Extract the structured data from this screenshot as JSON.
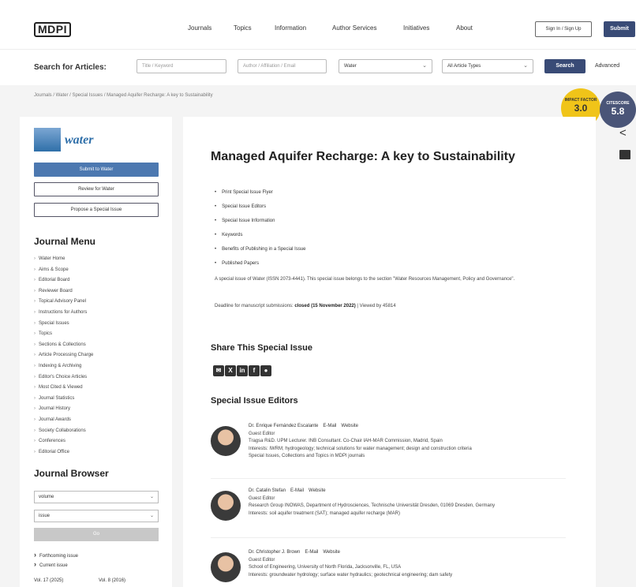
{
  "header": {
    "logo": "MDPI",
    "nav": [
      "Journals",
      "Topics",
      "Information",
      "Author Services",
      "Initiatives",
      "About"
    ],
    "sign_in": "Sign In / Sign Up",
    "submit": "Submit"
  },
  "search": {
    "label": "Search for Articles:",
    "title_placeholder": "Title / Keyword",
    "author_placeholder": "Author / Affiliation / Email",
    "journal_value": "Water",
    "type_value": "All Article Types",
    "search_button": "Search",
    "advanced": "Advanced"
  },
  "breadcrumb": "Journals / Water / Special Issues / Managed Aquifer Recharge: A key to Sustainability",
  "badges": {
    "impact_label": "IMPACT FACTOR",
    "impact_value": "3.0",
    "citescore_label": "CITESCORE",
    "citescore_value": "5.8"
  },
  "sidebar": {
    "journal_name": "water",
    "buttons": [
      "Submit to Water",
      "Review for Water",
      "Propose a Special Issue"
    ],
    "menu_title": "Journal Menu",
    "menu": [
      "Water Home",
      "Aims & Scope",
      "Editorial Board",
      "Reviewer Board",
      "Topical Advisory Panel",
      "Instructions for Authors",
      "Special Issues",
      "Topics",
      "Sections & Collections",
      "Article Processing Charge",
      "Indexing & Archiving",
      "Editor's Choice Articles",
      "Most Cited & Viewed",
      "Journal Statistics",
      "Journal History",
      "Journal Awards",
      "Society Collaborations",
      "Conferences",
      "Editorial Office"
    ],
    "browser_title": "Journal Browser",
    "volume_select": "volume",
    "issue_select": "issue",
    "go": "Go",
    "forthcoming": "Forthcoming issue",
    "current": "Current issue",
    "vol_left": "Vol. 17 (2025)",
    "vol_right": "Vol. 8 (2016)"
  },
  "main": {
    "title": "Managed Aquifer Recharge: A key to Sustainability",
    "toc": [
      "Print Special Issue Flyer",
      "Special Issue Editors",
      "Special Issue Information",
      "Keywords",
      "Benefits of Publishing in a Special Issue",
      "Published Papers"
    ],
    "description": "A special issue of Water (ISSN 2073-4441). This special issue belongs to the section \"Water Resources Management, Policy and Governance\".",
    "deadline_prefix": "Deadline for manuscript submissions:",
    "deadline_value": "closed (15 November 2022)",
    "deadline_suffix": " | Viewed by 45814",
    "share_title": "Share This Special Issue",
    "share_icons": [
      "email-icon",
      "x-icon",
      "linkedin-icon",
      "facebook-icon",
      "other-share-icon"
    ],
    "editors_title": "Special Issue Editors",
    "editors": [
      {
        "name": "Dr. Enrique Fernández Escalante",
        "email": "E-Mail",
        "website": "Website",
        "role": "Guest Editor",
        "affiliation": "Tragsa R&D. UPM Lecturer. INB Consultant. Co-Chair IAH-MAR Commission, Madrid, Spain",
        "interests": "Interests: IWRM; hydrogeology; technical solutions for water management; design and construction criteria",
        "extra": "Special Issues, Collections and Topics in MDPI journals"
      },
      {
        "name": "Dr. Catalin Stefan",
        "email": "E-Mail",
        "website": "Website",
        "role": "Guest Editor",
        "affiliation": "Research Group INOWAS, Department of Hydrosciences, Technische Universität Dresden, 01069 Dresden, Germany",
        "interests": "Interests: soil aquifer treatment (SAT); managed aquifer recharge (MAR)",
        "extra": ""
      },
      {
        "name": "Dr. Christopher J. Brown",
        "email": "E-Mail",
        "website": "Website",
        "role": "Guest Editor",
        "affiliation": "School of Engineering, University of North Florida, Jacksonville, FL, USA",
        "interests": "Interests: groundwater hydrology; surface water hydraulics; geotechnical engineering; dam safety",
        "extra": ""
      }
    ]
  }
}
